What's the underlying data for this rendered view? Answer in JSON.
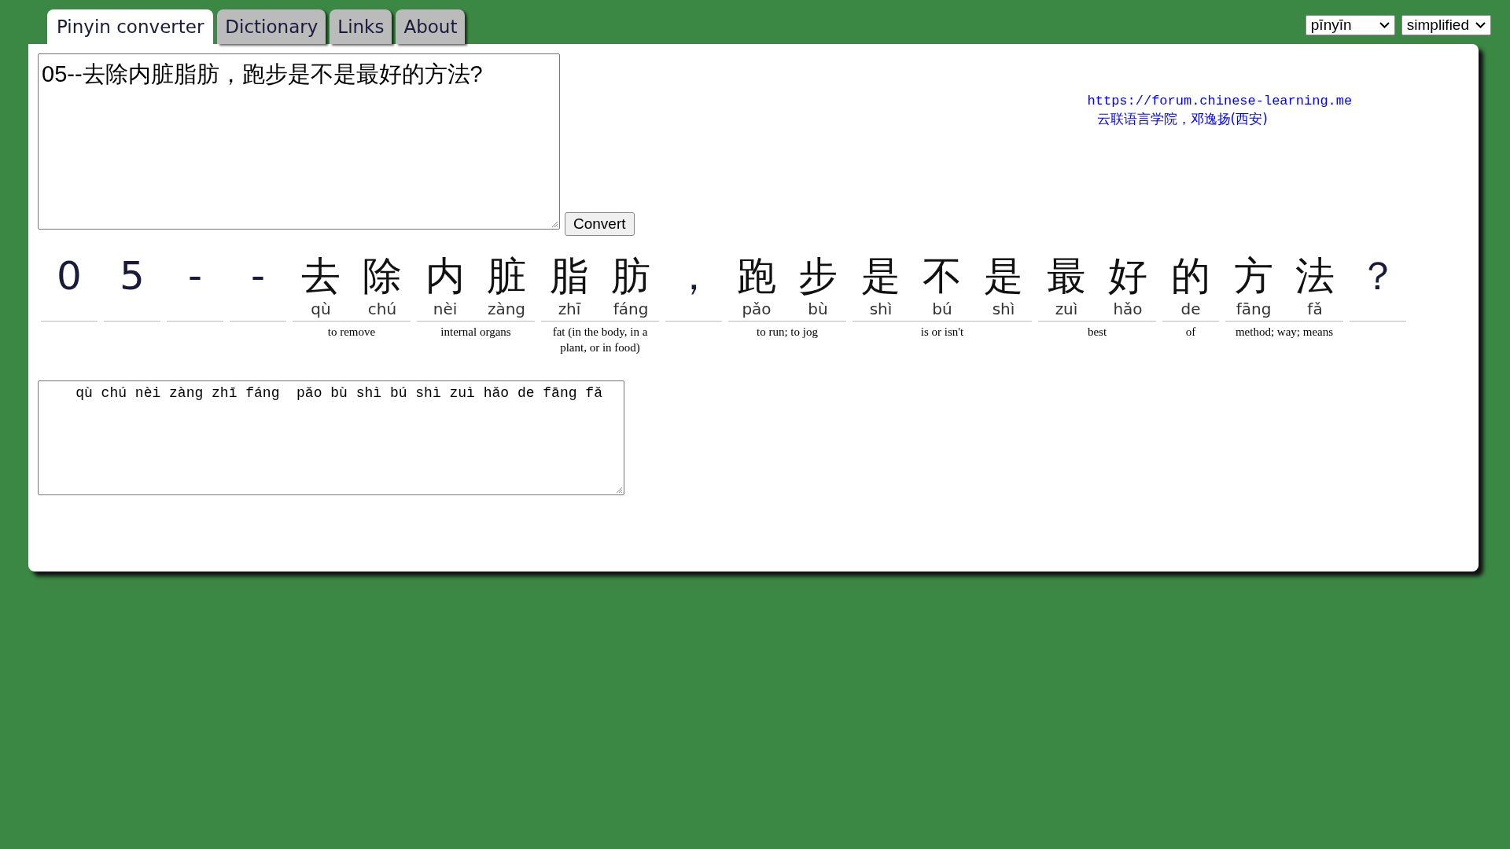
{
  "tabs": [
    {
      "label": "Pinyin converter",
      "selected": true
    },
    {
      "label": "Dictionary",
      "selected": false
    },
    {
      "label": "Links",
      "selected": false
    },
    {
      "label": "About",
      "selected": false
    }
  ],
  "selects": [
    {
      "value": "pīnyīn"
    },
    {
      "value": "simplified"
    }
  ],
  "input": {
    "value": "05--去除内脏脂肪，跑步是不是最好的方法?"
  },
  "convert_button": "Convert",
  "credit": {
    "link": "https://forum.chinese-learning.me",
    "text": "云联语言学院，邓逸扬(西安)"
  },
  "words": [
    {
      "chars": [
        {
          "hanzi": "0"
        }
      ]
    },
    {
      "chars": [
        {
          "hanzi": "5"
        }
      ]
    },
    {
      "chars": [
        {
          "hanzi": "-"
        }
      ]
    },
    {
      "chars": [
        {
          "hanzi": "-"
        }
      ]
    },
    {
      "chars": [
        {
          "hanzi": "去",
          "pinyin": "qù"
        },
        {
          "hanzi": "除",
          "pinyin": "chú"
        }
      ],
      "gloss": "to remove"
    },
    {
      "chars": [
        {
          "hanzi": "内",
          "pinyin": "nèi"
        },
        {
          "hanzi": "脏",
          "pinyin": "zàng"
        }
      ],
      "gloss": "internal organs"
    },
    {
      "chars": [
        {
          "hanzi": "脂",
          "pinyin": "zhī"
        },
        {
          "hanzi": "肪",
          "pinyin": "fáng"
        }
      ],
      "gloss": "fat (in the body, in a plant, or in food)"
    },
    {
      "chars": [
        {
          "hanzi": "，"
        }
      ]
    },
    {
      "chars": [
        {
          "hanzi": "跑",
          "pinyin": "pǎo"
        },
        {
          "hanzi": "步",
          "pinyin": "bù"
        }
      ],
      "gloss": "to run; to jog"
    },
    {
      "chars": [
        {
          "hanzi": "是",
          "pinyin": "shì"
        },
        {
          "hanzi": "不",
          "pinyin": "bú"
        },
        {
          "hanzi": "是",
          "pinyin": "shì"
        }
      ],
      "gloss": "is or isn't"
    },
    {
      "chars": [
        {
          "hanzi": "最",
          "pinyin": "zuì"
        },
        {
          "hanzi": "好",
          "pinyin": "hǎo"
        }
      ],
      "gloss": "best"
    },
    {
      "chars": [
        {
          "hanzi": "的",
          "pinyin": "de"
        }
      ],
      "gloss": "of"
    },
    {
      "chars": [
        {
          "hanzi": "方",
          "pinyin": "fāng"
        },
        {
          "hanzi": "法",
          "pinyin": "fǎ"
        }
      ],
      "gloss": "method; way; means"
    },
    {
      "chars": [
        {
          "hanzi": "？"
        }
      ]
    }
  ],
  "output": {
    "value": "    qù chú nèi zàng zhī fáng  pǎo bù shì bú shì zuì hǎo de fāng fǎ"
  }
}
